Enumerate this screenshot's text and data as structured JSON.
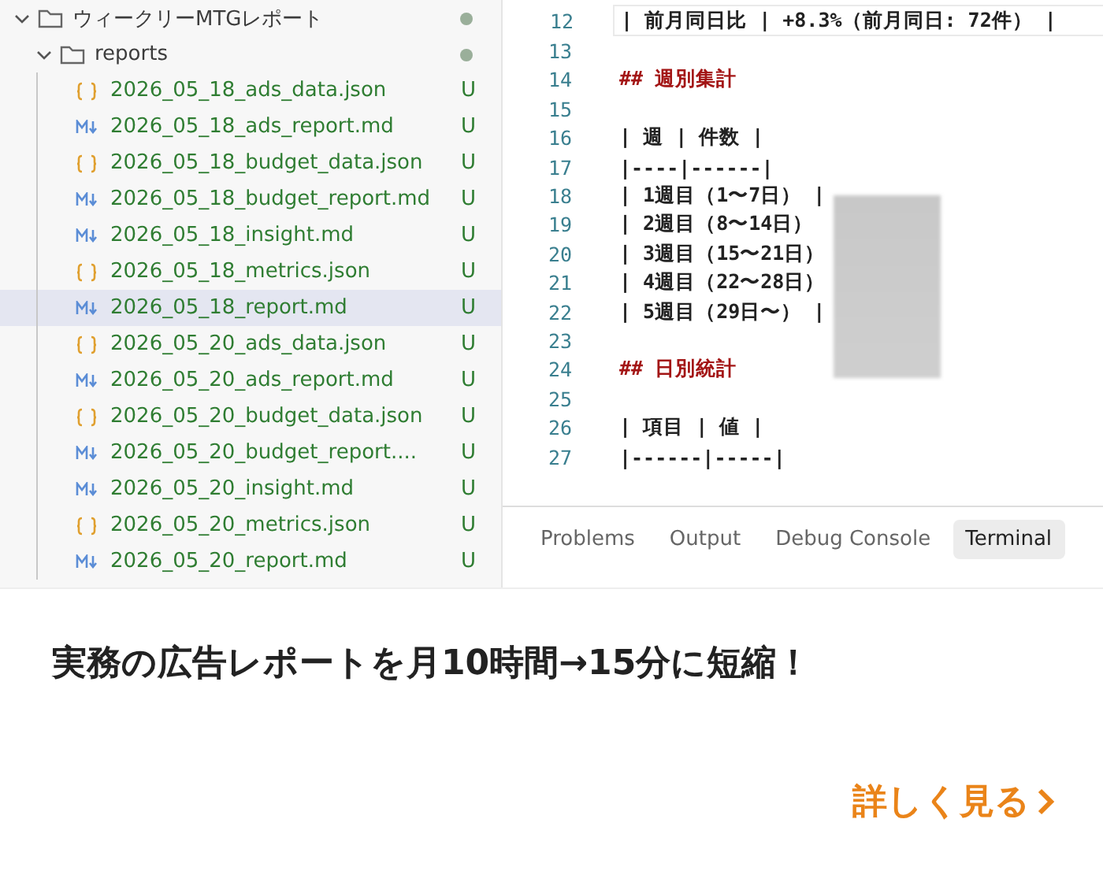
{
  "explorer": {
    "tree": [
      {
        "name": "ウィークリーMTGレポート",
        "kind": "folder",
        "expanded": true,
        "children": [
          {
            "name": "reports",
            "kind": "folder",
            "expanded": true,
            "children": [
              {
                "name": "2026_05_18_ads_data.json",
                "kind": "json",
                "status": "U",
                "selected": false
              },
              {
                "name": "2026_05_18_ads_report.md",
                "kind": "md",
                "status": "U",
                "selected": false
              },
              {
                "name": "2026_05_18_budget_data.json",
                "kind": "json",
                "status": "U",
                "selected": false
              },
              {
                "name": "2026_05_18_budget_report.md",
                "kind": "md",
                "status": "U",
                "selected": false
              },
              {
                "name": "2026_05_18_insight.md",
                "kind": "md",
                "status": "U",
                "selected": false
              },
              {
                "name": "2026_05_18_metrics.json",
                "kind": "json",
                "status": "U",
                "selected": false
              },
              {
                "name": "2026_05_18_report.md",
                "kind": "md",
                "status": "U",
                "selected": true
              },
              {
                "name": "2026_05_20_ads_data.json",
                "kind": "json",
                "status": "U",
                "selected": false
              },
              {
                "name": "2026_05_20_ads_report.md",
                "kind": "md",
                "status": "U",
                "selected": false
              },
              {
                "name": "2026_05_20_budget_data.json",
                "kind": "json",
                "status": "U",
                "selected": false
              },
              {
                "name": "2026_05_20_budget_report....",
                "kind": "md",
                "status": "U",
                "selected": false
              },
              {
                "name": "2026_05_20_insight.md",
                "kind": "md",
                "status": "U",
                "selected": false
              },
              {
                "name": "2026_05_20_metrics.json",
                "kind": "json",
                "status": "U",
                "selected": false
              },
              {
                "name": "2026_05_20_report.md",
                "kind": "md",
                "status": "U",
                "selected": false
              }
            ]
          }
        ]
      }
    ]
  },
  "editor": {
    "lines": [
      {
        "number": "12",
        "text": "| 前月同日比 | +8.3%（前月同日: 72件） |",
        "kind": "text",
        "current": true
      },
      {
        "number": "13",
        "current": false
      },
      {
        "number": "14",
        "text": "## 週別集計",
        "kind": "heading",
        "current": false
      },
      {
        "number": "15",
        "current": false
      },
      {
        "number": "16",
        "text": "| 週 | 件数 |",
        "kind": "text",
        "current": false
      },
      {
        "number": "17",
        "text": "|----|------|",
        "kind": "text",
        "current": false
      },
      {
        "number": "18",
        "text": "| 1週目（1〜7日） |",
        "kind": "text",
        "current": false
      },
      {
        "number": "19",
        "text": "| 2週目（8〜14日）",
        "kind": "text",
        "current": false
      },
      {
        "number": "20",
        "text": "| 3週目（15〜21日）",
        "kind": "text",
        "current": false
      },
      {
        "number": "21",
        "text": "| 4週目（22〜28日）",
        "kind": "text",
        "current": false
      },
      {
        "number": "22",
        "text": "| 5週目（29日〜） |",
        "kind": "text",
        "current": false
      },
      {
        "number": "23",
        "current": false
      },
      {
        "number": "24",
        "text": "## 日別統計",
        "kind": "heading",
        "current": false
      },
      {
        "number": "25",
        "current": false
      },
      {
        "number": "26",
        "text": "| 項目 | 値 |",
        "kind": "text",
        "current": false
      },
      {
        "number": "27",
        "text": "|------|-----|",
        "kind": "text",
        "current": false
      }
    ]
  },
  "panel": {
    "tabs": [
      {
        "label": "Problems",
        "selected": false
      },
      {
        "label": "Output",
        "selected": false
      },
      {
        "label": "Debug Console",
        "selected": false
      },
      {
        "label": "Terminal",
        "selected": true
      }
    ]
  },
  "card": {
    "title": "実務の広告レポートを月10時間→15分に短縮！",
    "link": "詳しく見る"
  }
}
